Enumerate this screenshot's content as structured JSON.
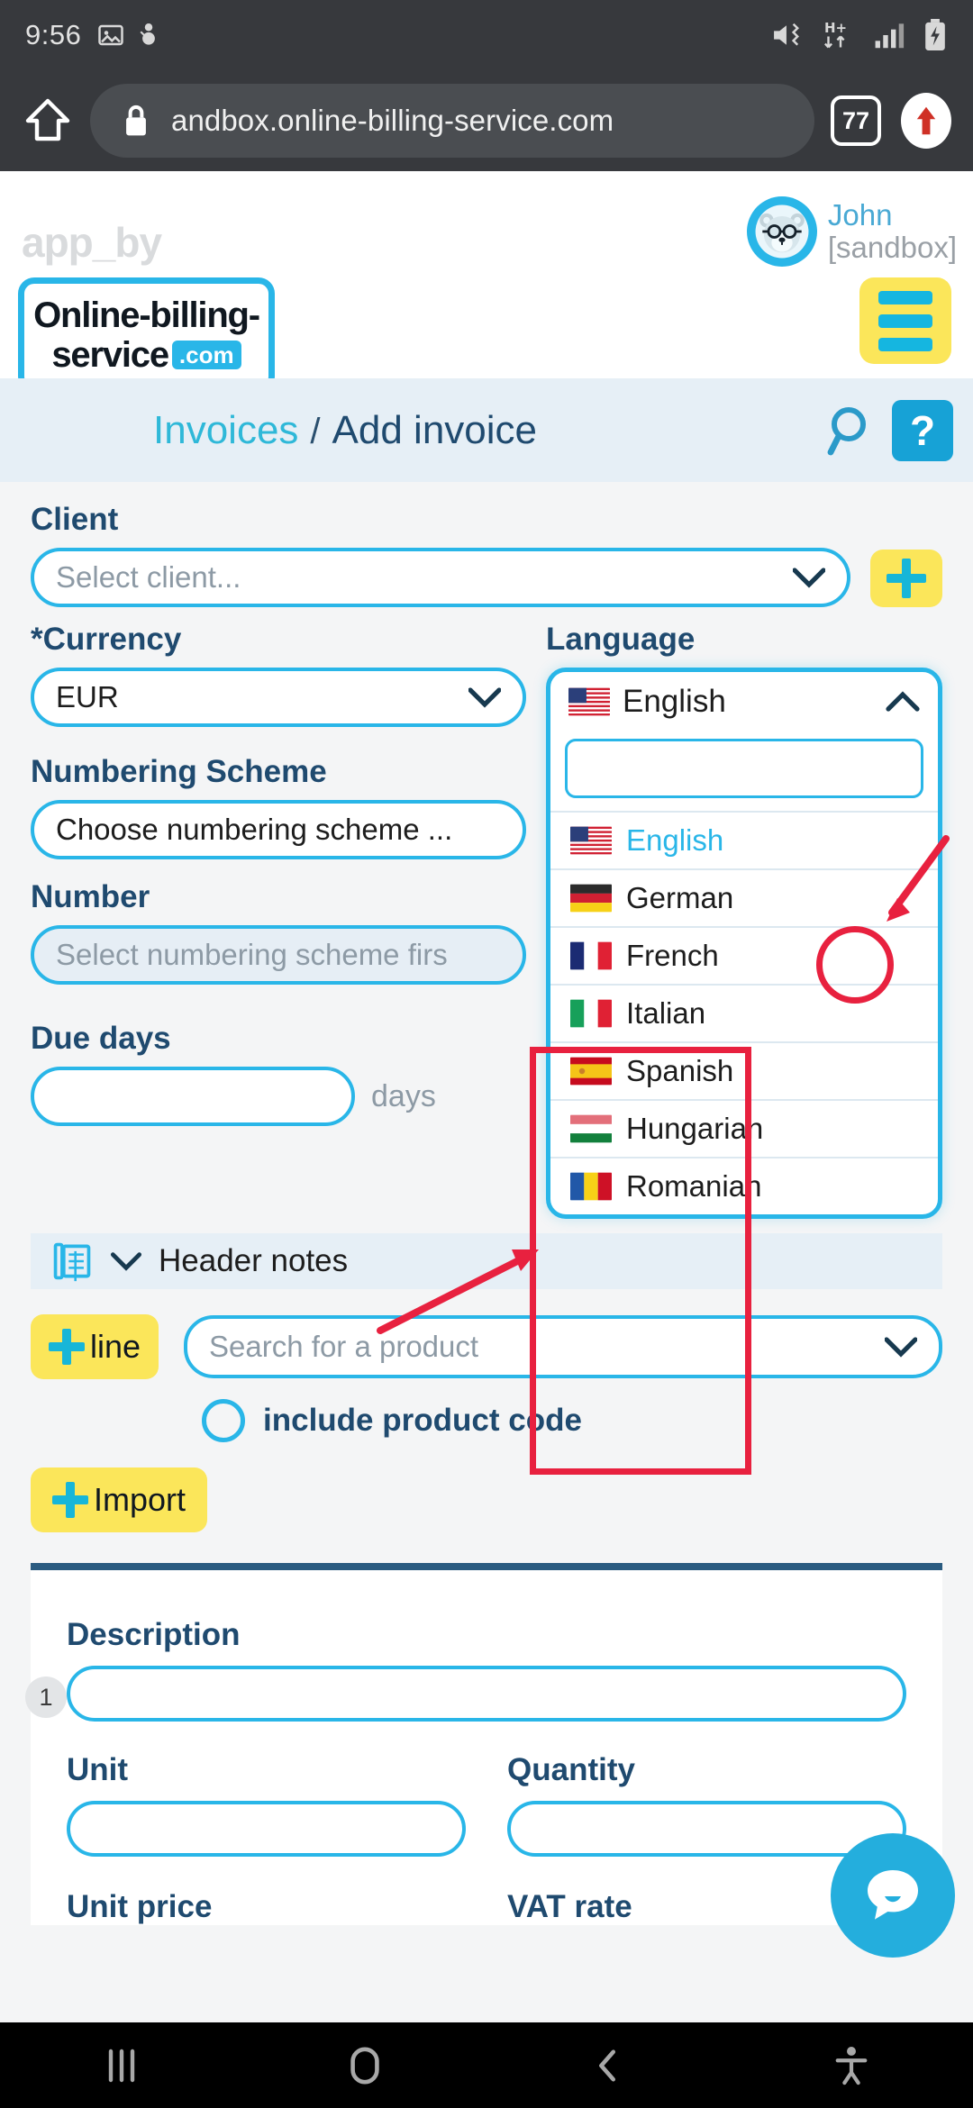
{
  "status_bar": {
    "time": "9:56",
    "left_icons": [
      "image-icon",
      "snowman-icon"
    ],
    "right_icons": [
      "mute-vibrate-icon",
      "hplus-data-icon",
      "signal-bars-icon",
      "battery-charging-icon"
    ]
  },
  "browser": {
    "home_icon": "home-icon",
    "lock_icon": "lock-icon",
    "url": "andbox.online-billing-service.com",
    "tab_count": "77",
    "download_icon": "upload-arrow-icon"
  },
  "app_header": {
    "app_by": "app_by",
    "logo_line1": "Online-billing-",
    "logo_line2": "service",
    "logo_tld": ".com",
    "user_name": "John",
    "user_env": "[sandbox]",
    "avatar_icon": "bear-avatar-icon",
    "menu_icon": "hamburger-menu-icon"
  },
  "breadcrumb": {
    "parent": "Invoices",
    "separator": "/",
    "current": "Add invoice",
    "search_icon": "search-icon",
    "help_label": "?"
  },
  "form": {
    "client_label": "Client",
    "client_placeholder": "Select client...",
    "add_client_icon": "plus-icon",
    "currency_label": "Currency",
    "currency_value": "EUR",
    "language_label": "Language",
    "numbering_label": "Numbering Scheme",
    "numbering_placeholder": "Choose numbering scheme ...",
    "number_label": "Number",
    "number_placeholder": "Select numbering scheme firs",
    "due_days_label": "Due days",
    "due_days_value": "",
    "due_days_suffix": "days",
    "header_notes_label": "Header notes",
    "header_notes_icon": "notebook-icon",
    "header_notes_chevron": "chevron-down-icon"
  },
  "language_dropdown": {
    "selected": "English",
    "selected_flag": "flag-us",
    "toggle_icon": "chevron-up-icon",
    "search_value": "",
    "options": [
      {
        "label": "English",
        "flag": "flag-us",
        "selected": true
      },
      {
        "label": "German",
        "flag": "flag-de",
        "selected": false
      },
      {
        "label": "French",
        "flag": "flag-fr",
        "selected": false
      },
      {
        "label": "Italian",
        "flag": "flag-it",
        "selected": false
      },
      {
        "label": "Spanish",
        "flag": "flag-es",
        "selected": false
      },
      {
        "label": "Hungarian",
        "flag": "flag-hu",
        "selected": false
      },
      {
        "label": "Romanian",
        "flag": "flag-ro",
        "selected": false
      }
    ]
  },
  "lines": {
    "add_line_label": "line",
    "add_line_icon": "plus-icon",
    "product_placeholder": "Search for a product",
    "include_code_label": "include product code",
    "import_label": "Import",
    "import_icon": "plus-icon"
  },
  "item": {
    "row_number": "1",
    "description_label": "Description",
    "description_value": "",
    "unit_label": "Unit",
    "unit_value": "",
    "quantity_label": "Quantity",
    "quantity_value": "",
    "unit_price_label": "Unit price",
    "vat_rate_label": "VAT rate"
  },
  "chat": {
    "icon": "chat-bubble-icon"
  },
  "nav_bar": {
    "recents_icon": "recents-icon",
    "home_icon": "home-circle-icon",
    "back_icon": "back-chevron-icon",
    "accessibility_icon": "accessibility-icon"
  },
  "colors": {
    "accent_cyan": "#29b6e8",
    "navy": "#1f4a6f",
    "yellow": "#fbe65a",
    "annotation_red": "#e8213f",
    "bar_dark": "#37393d"
  }
}
